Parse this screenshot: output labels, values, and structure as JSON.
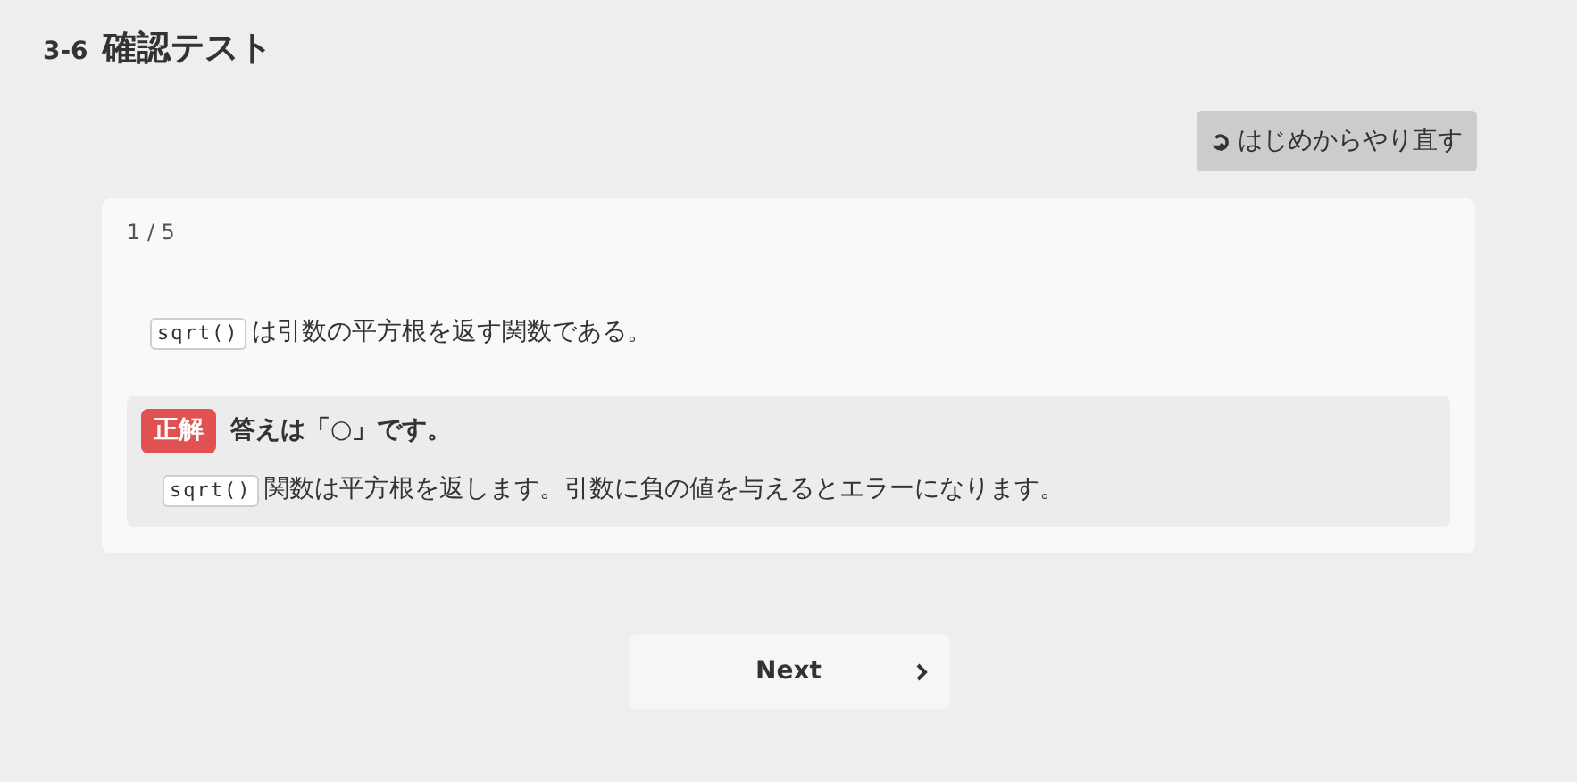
{
  "header": {
    "number": "3-6",
    "title": "確認テスト"
  },
  "restart_button": {
    "label": "はじめからやり直す"
  },
  "quiz": {
    "progress": "1 / 5",
    "question": [
      {
        "kind": "code",
        "text": "sqrt()"
      },
      {
        "kind": "text",
        "text": "は引数の平方根を返す関数である。"
      }
    ],
    "result": {
      "kind": "correct",
      "badge": "正解",
      "answer": "答えは「○」です。",
      "explanation": [
        {
          "kind": "code",
          "text": "sqrt()"
        },
        {
          "kind": "text",
          "text": "関数は平方根を返します。引数に負の値を与えるとエラーになります。"
        }
      ]
    }
  },
  "next_button": {
    "label": "Next"
  }
}
